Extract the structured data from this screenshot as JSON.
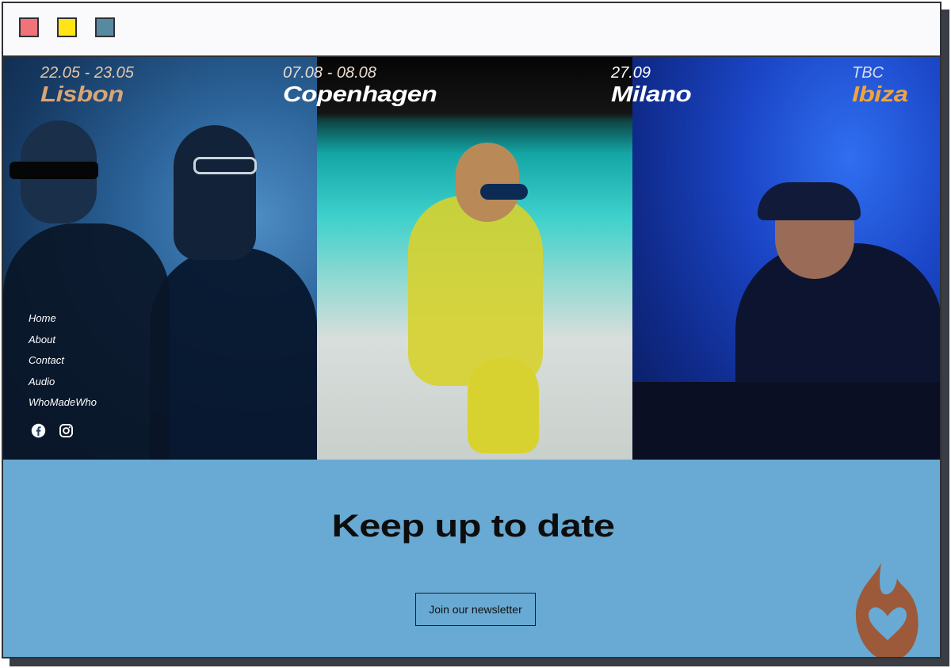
{
  "window": {
    "controls": [
      {
        "name": "close",
        "color": "#f07379"
      },
      {
        "name": "minimize",
        "color": "#ffe418"
      },
      {
        "name": "maximize",
        "color": "#568aa1"
      }
    ]
  },
  "events": [
    {
      "date": "22.05 - 23.05",
      "city": "Lisbon"
    },
    {
      "date": "07.08 - 08.08",
      "city": "Copenhagen"
    },
    {
      "date": "27.09",
      "city": "Milano"
    },
    {
      "date": "TBC",
      "city": "Ibiza"
    }
  ],
  "nav": {
    "items": [
      "Home",
      "About",
      "Contact",
      "Audio",
      "WhoMadeWho"
    ]
  },
  "social": {
    "icons": [
      "facebook-icon",
      "instagram-icon"
    ]
  },
  "newsletter": {
    "title": "Keep up to date",
    "button_label": "Join our newsletter",
    "background": "#68aad3"
  },
  "colors": {
    "accent_orange": "#f0a43b",
    "city_tan": "#d9a578",
    "logo_brown": "#9c5a3a"
  }
}
